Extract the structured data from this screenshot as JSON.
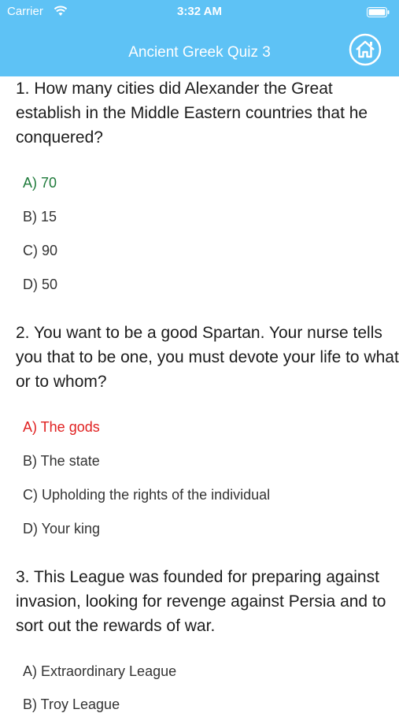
{
  "status": {
    "carrier": "Carrier",
    "time": "3:32 AM"
  },
  "header": {
    "title": "Ancient Greek Quiz 3",
    "home_icon": "home-icon"
  },
  "questions": [
    {
      "text": "1. How many cities did Alexander the Great establish in the Middle Eastern countries that he conquered?",
      "options": [
        "A) 70",
        "B) 15",
        "C) 90",
        "D) 50"
      ],
      "state": "A correct (green)"
    },
    {
      "text": "2. You want to be a good Spartan. Your nurse tells you that to be one, you must devote your life to what or to whom?",
      "options": [
        "A) The gods",
        "B) The state",
        "C) Upholding the rights of the individual",
        "D) Your king"
      ],
      "state": "A wrong (red)"
    },
    {
      "text": "3. This League was founded for preparing against invasion, looking for revenge against Persia and to sort out the rewards of war.",
      "options": [
        "A) Extraordinary League",
        "B) Troy League"
      ]
    }
  ],
  "colors": {
    "header_bg": "#5ec2f5",
    "correct": "#1e7a3a",
    "wrong": "#e02020"
  }
}
